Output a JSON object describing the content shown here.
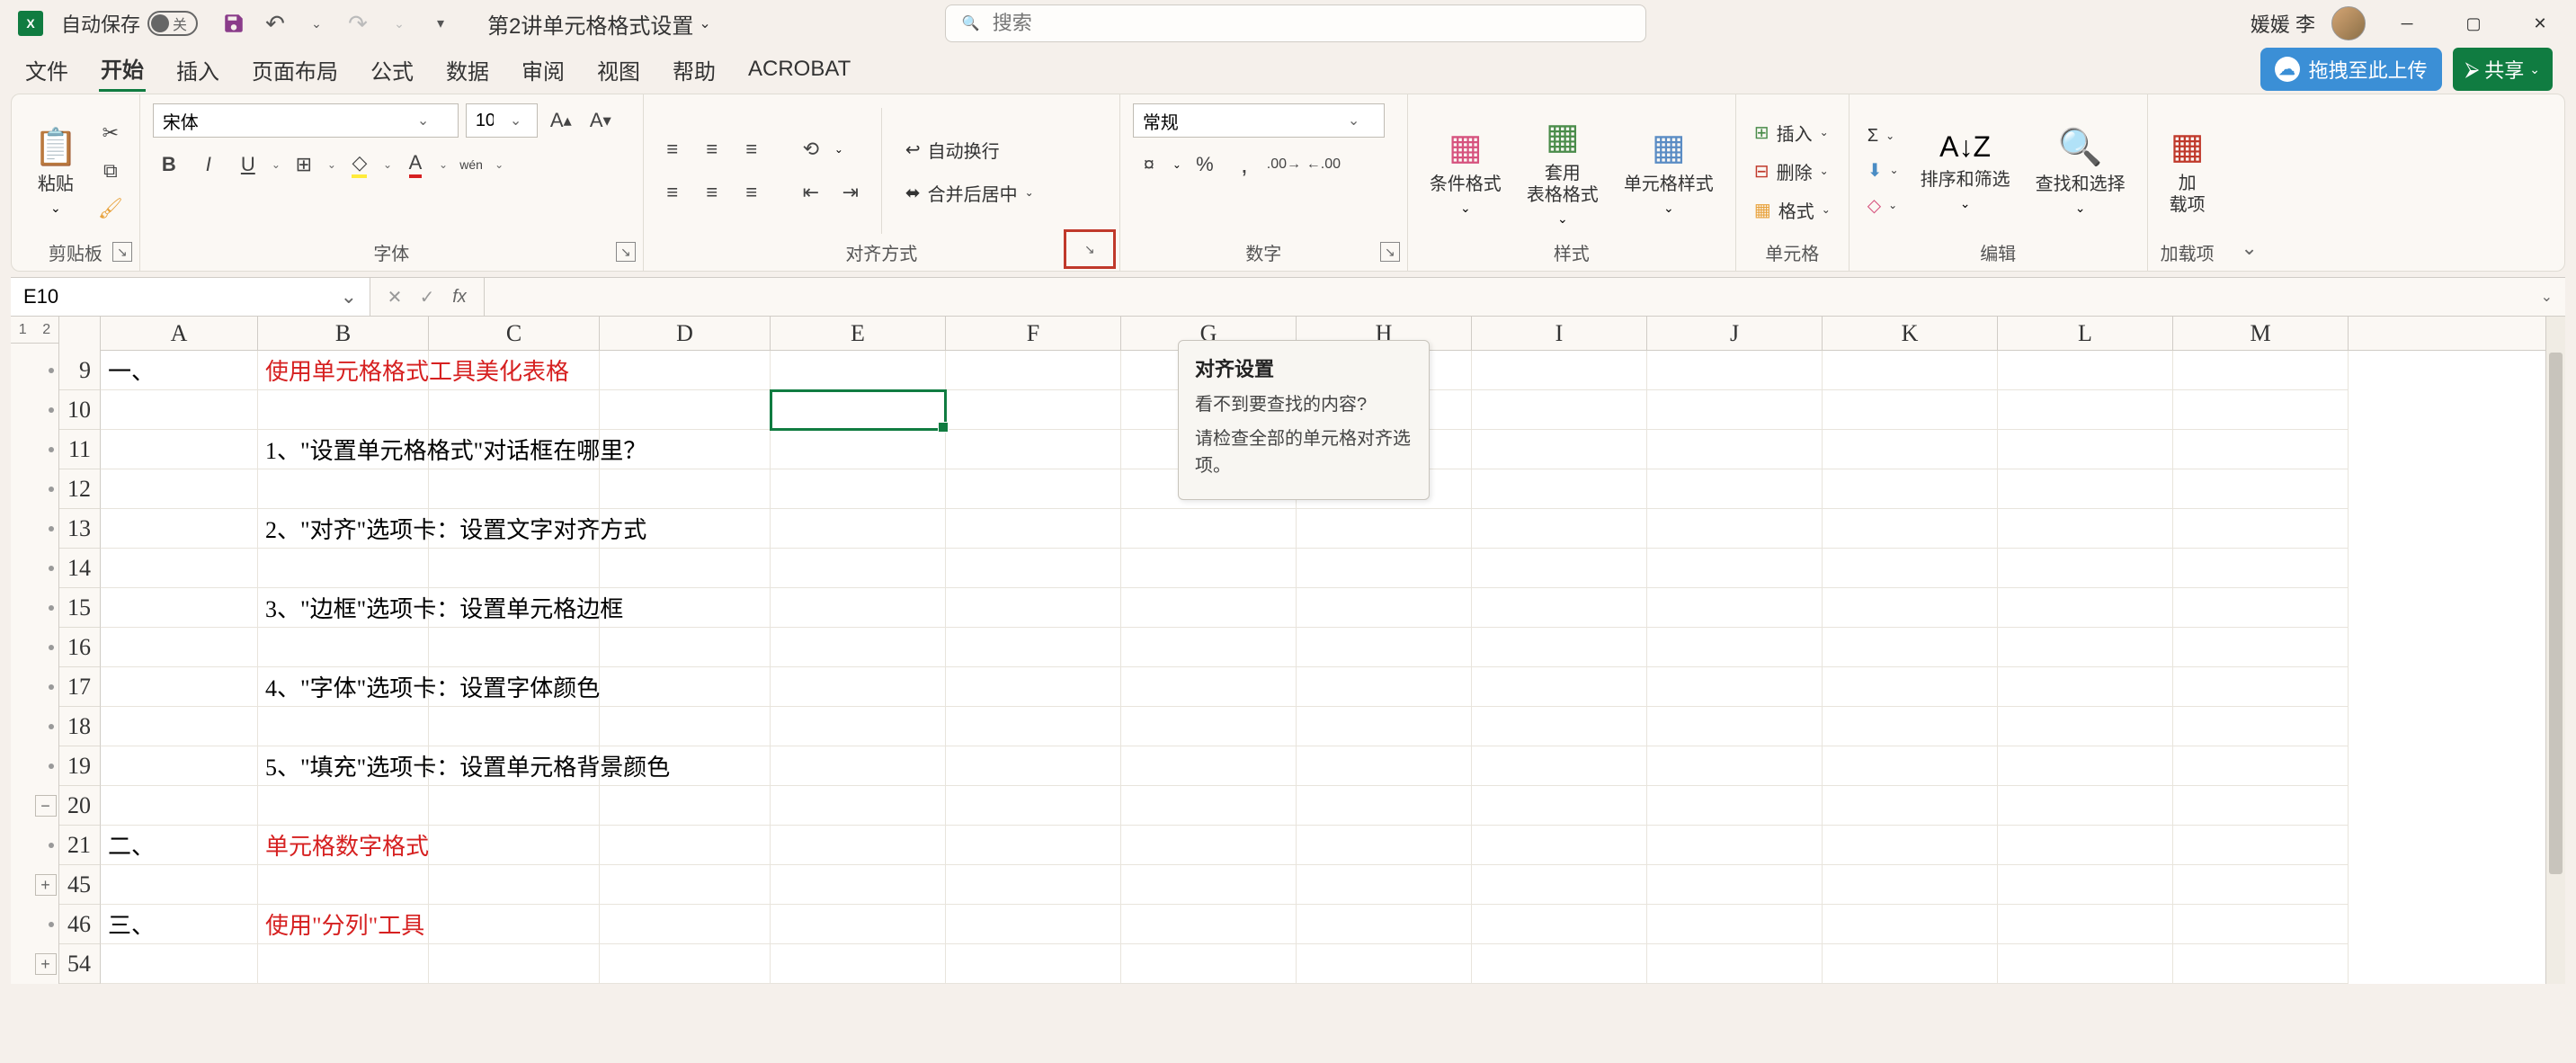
{
  "title_bar": {
    "autosave_label": "自动保存",
    "autosave_state": "关",
    "doc_title": "第2讲单元格格式设置",
    "search_placeholder": "搜索",
    "user_name": "媛媛 李"
  },
  "tabs": {
    "items": [
      "文件",
      "开始",
      "插入",
      "页面布局",
      "公式",
      "数据",
      "审阅",
      "视图",
      "帮助",
      "ACROBAT"
    ],
    "active_index": 1,
    "upload_label": "拖拽至此上传",
    "share_label": "共享"
  },
  "ribbon": {
    "clipboard": {
      "paste": "粘贴",
      "label": "剪贴板"
    },
    "font": {
      "name": "宋体",
      "size": "10",
      "bold": "B",
      "italic": "I",
      "underline": "U",
      "phonetic": "wén",
      "label": "字体"
    },
    "alignment": {
      "wrap": "自动换行",
      "merge": "合并后居中",
      "label": "对齐方式"
    },
    "number": {
      "format": "常规",
      "label": "数字"
    },
    "styles": {
      "conditional": "条件格式",
      "table": "套用\n表格格式",
      "cell_styles": "单元格样式",
      "label": "样式"
    },
    "cells": {
      "insert": "插入",
      "delete": "删除",
      "format": "格式",
      "label": "单元格"
    },
    "editing": {
      "sort": "排序和筛选",
      "find": "查找和选择",
      "label": "编辑"
    },
    "addins": {
      "btn": "加\n载项",
      "label": "加载项"
    }
  },
  "tooltip": {
    "title": "对齐设置",
    "line1": "看不到要查找的内容?",
    "line2": "请检查全部的单元格对齐选项。"
  },
  "formula_bar": {
    "name_box": "E10"
  },
  "grid": {
    "sheet_tabs": [
      "1",
      "2"
    ],
    "columns": [
      "A",
      "B",
      "C",
      "D",
      "E",
      "F",
      "G",
      "H",
      "I",
      "J",
      "K",
      "L",
      "M"
    ],
    "rows": [
      {
        "num": "9",
        "A": "一、",
        "B": "使用单元格格式工具美化表格",
        "B_red": true
      },
      {
        "num": "10",
        "A": "",
        "B": "",
        "selected_col": "E"
      },
      {
        "num": "11",
        "A": "",
        "B": "1、\"设置单元格格式\"对话框在哪里？"
      },
      {
        "num": "12",
        "A": "",
        "B": ""
      },
      {
        "num": "13",
        "A": "",
        "B": "2、\"对齐\"选项卡：设置文字对齐方式"
      },
      {
        "num": "14",
        "A": "",
        "B": ""
      },
      {
        "num": "15",
        "A": "",
        "B": "3、\"边框\"选项卡：设置单元格边框"
      },
      {
        "num": "16",
        "A": "",
        "B": ""
      },
      {
        "num": "17",
        "A": "",
        "B": "4、\"字体\"选项卡：设置字体颜色"
      },
      {
        "num": "18",
        "A": "",
        "B": ""
      },
      {
        "num": "19",
        "A": "",
        "B": "5、\"填充\"选项卡：设置单元格背景颜色"
      },
      {
        "num": "20",
        "A": "",
        "B": ""
      },
      {
        "num": "21",
        "A": "二、",
        "B": "单元格数字格式",
        "B_red": true
      },
      {
        "num": "45",
        "A": "",
        "B": ""
      },
      {
        "num": "46",
        "A": "三、",
        "B": "使用\"分列\"工具",
        "B_red": true
      },
      {
        "num": "54",
        "A": "",
        "B": ""
      }
    ],
    "outline_buttons": [
      "−",
      "+",
      "+"
    ]
  }
}
